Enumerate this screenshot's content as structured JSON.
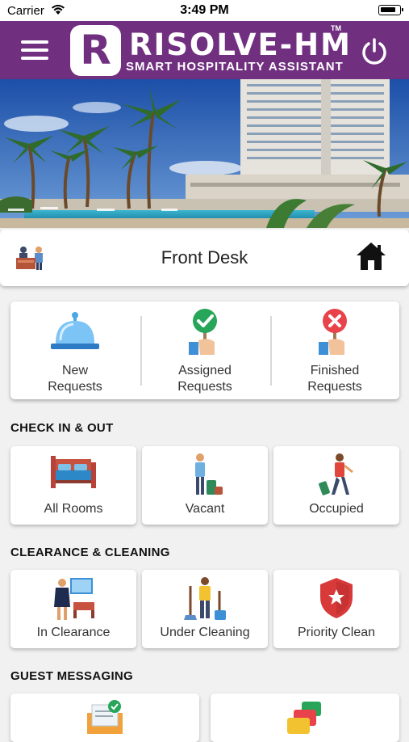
{
  "status_bar": {
    "carrier": "Carrier",
    "time": "3:49 PM"
  },
  "app": {
    "brand": "RISOLVE-HM",
    "trademark": "TM",
    "tagline": "SMART HOSPITALITY ASSISTANT",
    "logo_letter": "R",
    "accent_color": "#712f80"
  },
  "desk": {
    "title": "Front Desk"
  },
  "requests": [
    {
      "label_line1": "New",
      "label_line2": "Requests",
      "icon": "service-bell-icon"
    },
    {
      "label_line1": "Assigned",
      "label_line2": "Requests",
      "icon": "hand-check-sign-icon"
    },
    {
      "label_line1": "Finished",
      "label_line2": "Requests",
      "icon": "hand-x-sign-icon"
    }
  ],
  "sections": {
    "check_in_out": {
      "title": "CHECK IN & OUT",
      "tiles": [
        {
          "label": "All Rooms",
          "icon": "bed-icon"
        },
        {
          "label": "Vacant",
          "icon": "guest-luggage-icon"
        },
        {
          "label": "Occupied",
          "icon": "traveler-icon"
        }
      ]
    },
    "clearance_cleaning": {
      "title": "CLEARANCE & CLEANING",
      "tiles": [
        {
          "label": "In Clearance",
          "icon": "housekeeper-icon"
        },
        {
          "label": "Under Cleaning",
          "icon": "cleaner-icon"
        },
        {
          "label": "Priority Clean",
          "icon": "shield-star-icon"
        }
      ]
    },
    "guest_messaging": {
      "title": "GUEST MESSAGING",
      "tiles": [
        {
          "label": "",
          "icon": "envelope-check-icon"
        },
        {
          "label": "",
          "icon": "chat-bubbles-icon"
        }
      ]
    }
  }
}
